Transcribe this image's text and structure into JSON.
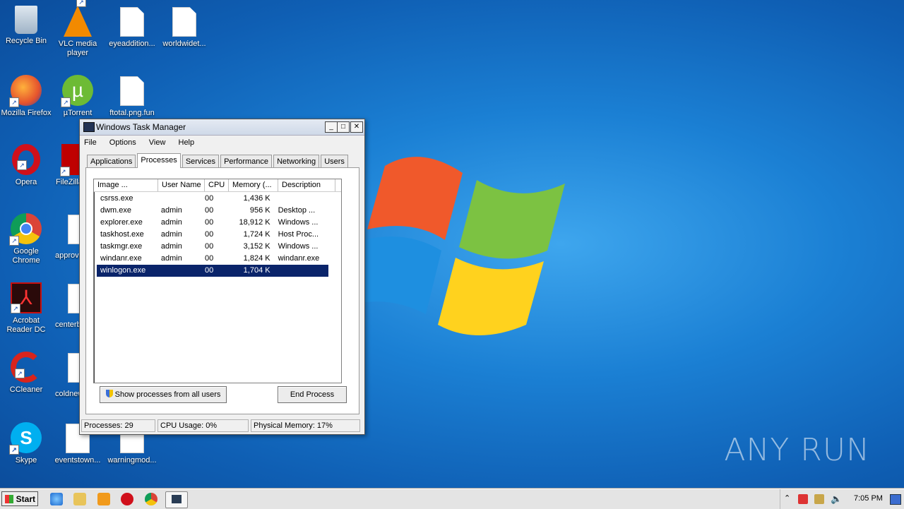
{
  "desktop": {
    "icons": [
      {
        "label": "Recycle Bin"
      },
      {
        "label": "VLC media player"
      },
      {
        "label": "eyeaddition..."
      },
      {
        "label": "worldwidet..."
      },
      {
        "label": "Mozilla Firefox"
      },
      {
        "label": "µTorrent"
      },
      {
        "label": "ftotal.png.fun"
      },
      {
        "label": "Opera"
      },
      {
        "label": "FileZilla"
      },
      {
        "label": "Google Chrome"
      },
      {
        "label": "approv"
      },
      {
        "label": "Acrobat Reader DC"
      },
      {
        "label": "centerb"
      },
      {
        "label": "CCleaner"
      },
      {
        "label": "coldnew"
      },
      {
        "label": "Skype"
      },
      {
        "label": "eventstown..."
      },
      {
        "label": "warningmod..."
      }
    ],
    "watermark": "ANY RUN"
  },
  "taskmgr": {
    "title": "Windows Task Manager",
    "menu": [
      "File",
      "Options",
      "View",
      "Help"
    ],
    "tabs": [
      "Applications",
      "Processes",
      "Services",
      "Performance",
      "Networking",
      "Users"
    ],
    "columns": [
      "Image ...",
      "User Name",
      "CPU",
      "Memory (...",
      "Description"
    ],
    "rows": [
      [
        "csrss.exe",
        "",
        "00",
        "1,436 K",
        ""
      ],
      [
        "dwm.exe",
        "admin",
        "00",
        "956 K",
        "Desktop ..."
      ],
      [
        "explorer.exe",
        "admin",
        "00",
        "18,912 K",
        "Windows ..."
      ],
      [
        "taskhost.exe",
        "admin",
        "00",
        "1,724 K",
        "Host Proc..."
      ],
      [
        "taskmgr.exe",
        "admin",
        "00",
        "3,152 K",
        "Windows ..."
      ],
      [
        "windanr.exe",
        "admin",
        "00",
        "1,824 K",
        "windanr.exe"
      ],
      [
        "winlogon.exe",
        "",
        "00",
        "1,704 K",
        ""
      ]
    ],
    "show_all_label": "Show processes from all users",
    "end_process_label": "End Process",
    "status": {
      "processes": "Processes: 29",
      "cpu": "CPU Usage: 0%",
      "memory": "Physical Memory: 17%"
    }
  },
  "taskbar": {
    "start_label": "Start",
    "clock": "7:05 PM"
  }
}
